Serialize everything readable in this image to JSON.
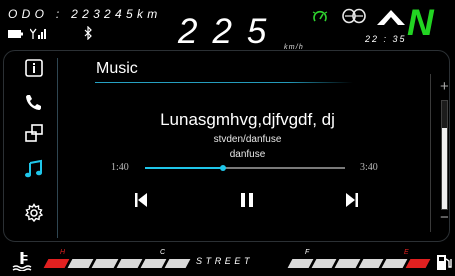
{
  "status_bar": {
    "odo": "ODO : 223245km",
    "speed": "225",
    "speed_unit": "km/h",
    "time": "22 : 35",
    "gear": "N",
    "icons": [
      "battery-icon",
      "signal-icon",
      "bluetooth-icon",
      "headlight-icon",
      "tire-icon",
      "chevron-up-icon"
    ]
  },
  "sidebar": {
    "items": [
      {
        "id": "info",
        "icon": "info-icon"
      },
      {
        "id": "phone",
        "icon": "phone-icon"
      },
      {
        "id": "connect",
        "icon": "screen-mirror-icon"
      },
      {
        "id": "music",
        "icon": "music-note-icon"
      },
      {
        "id": "settings",
        "icon": "gear-icon"
      }
    ],
    "active": "music"
  },
  "player": {
    "title": "Music",
    "song": "Lunasgmhvg,djfvgdf, dj",
    "artist": "stvden/danfuse",
    "album": "danfuse",
    "elapsed": "1:40",
    "duration": "3:40",
    "progress": 0.39,
    "controls": [
      "previous-icon",
      "pause-icon",
      "next-icon"
    ]
  },
  "volume": {
    "plus": "+",
    "minus": "−",
    "level": 0.75
  },
  "bottom": {
    "temp": {
      "high": "H",
      "low": "C"
    },
    "mode": "STREET",
    "fuel": {
      "full": "F",
      "empty": "E"
    }
  },
  "colors": {
    "accent": "#1fc6ea",
    "gear": "#22d422",
    "warning": "#e02020"
  }
}
